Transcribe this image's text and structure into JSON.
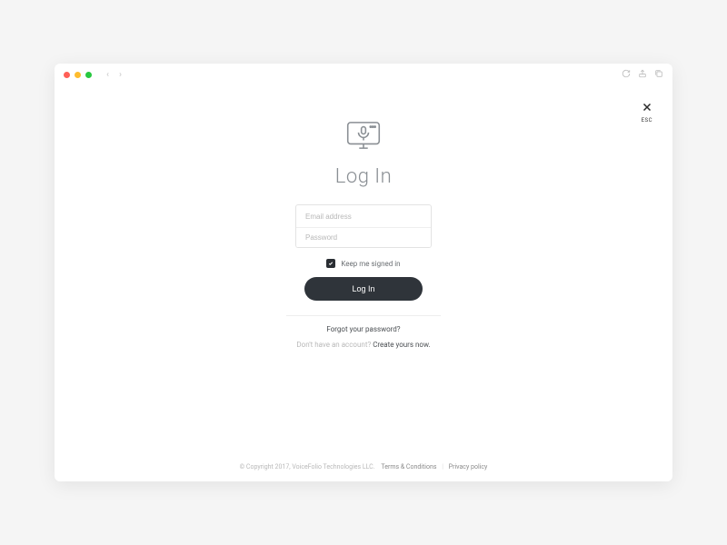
{
  "browser": {
    "esc_label": "ESC"
  },
  "logo": {
    "name": "microphone-monitor-icon"
  },
  "page": {
    "title": "Log In"
  },
  "form": {
    "email_placeholder": "Email address",
    "password_placeholder": "Password",
    "keep_signed_label": "Keep me signed in",
    "keep_signed_checked": true,
    "submit_label": "Log In"
  },
  "links": {
    "forgot_label": "Forgot your password?",
    "no_account_prefix": "Don't have an account?",
    "create_label": "Create yours now."
  },
  "footer": {
    "copyright": "© Copyright 2017, VoiceFolio Technologies LLC.",
    "terms_label": "Terms & Conditions",
    "privacy_label": "Privacy policy"
  }
}
